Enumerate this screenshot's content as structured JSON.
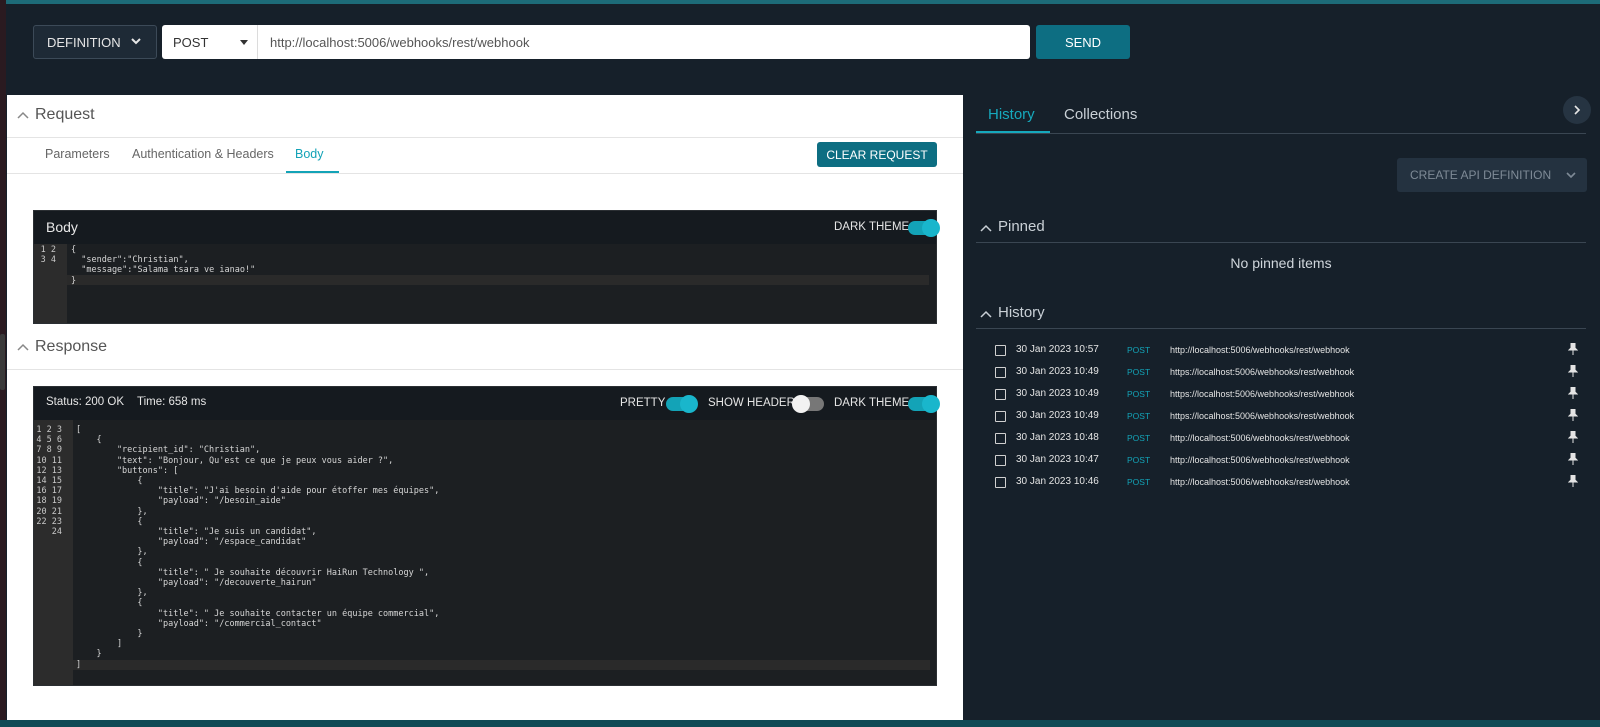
{
  "topbar": {
    "definition_label": "DEFINITION",
    "method": "POST",
    "url": "http://localhost:5006/webhooks/rest/webhook",
    "send_label": "SEND"
  },
  "request": {
    "title": "Request",
    "tabs": [
      "Parameters",
      "Authentication & Headers",
      "Body"
    ],
    "active_tab": "Body",
    "clear_label": "CLEAR REQUEST",
    "body_editor": {
      "title": "Body",
      "dark_theme_label": "DARK THEME",
      "dark_theme_on": true,
      "line_numbers": "1\n2\n3\n4",
      "code": "{\n  \"sender\":\"Christian\",\n  \"message\":\"Salama tsara ve ianao!\"\n}"
    }
  },
  "response": {
    "title": "Response",
    "status": "Status: 200 OK",
    "time": "Time: 658 ms",
    "pretty_label": "PRETTY",
    "pretty_on": true,
    "show_headers_label": "SHOW HEADERS",
    "show_headers_on": false,
    "dark_theme_label": "DARK THEME",
    "dark_theme_on": true,
    "line_numbers": "1\n2\n3\n4\n5\n6\n7\n8\n9\n10\n11\n12\n13\n14\n15\n16\n17\n18\n19\n20\n21\n22\n23\n24",
    "code": "[\n    {\n        \"recipient_id\": \"Christian\",\n        \"text\": \"Bonjour, Qu'est ce que je peux vous aider ?\",\n        \"buttons\": [\n            {\n                \"title\": \"J'ai besoin d'aide pour étoffer mes équipes\",\n                \"payload\": \"/besoin_aide\"\n            },\n            {\n                \"title\": \"Je suis un candidat\",\n                \"payload\": \"/espace_candidat\"\n            },\n            {\n                \"title\": \" Je souhaite découvrir HaiRun Technology \",\n                \"payload\": \"/decouverte_hairun\"\n            },\n            {\n                \"title\": \" Je souhaite contacter un équipe commercial\",\n                \"payload\": \"/commercial_contact\"\n            }\n        ]\n    }\n]"
  },
  "sidebar": {
    "tabs": [
      "History",
      "Collections"
    ],
    "active_tab": "History",
    "create_label": "CREATE API DEFINITION",
    "pinned_title": "Pinned",
    "no_pinned": "No pinned items",
    "history_title": "History",
    "history": [
      {
        "date": "30 Jan 2023 10:57",
        "method": "POST",
        "url": "http://localhost:5006/webhooks/rest/webhook"
      },
      {
        "date": "30 Jan 2023 10:49",
        "method": "POST",
        "url": "https://localhost:5006/webhooks/rest/webhook"
      },
      {
        "date": "30 Jan 2023 10:49",
        "method": "POST",
        "url": "https://localhost:5006/webhooks/rest/webhook"
      },
      {
        "date": "30 Jan 2023 10:49",
        "method": "POST",
        "url": "https://localhost:5006/webhooks/rest/webhook"
      },
      {
        "date": "30 Jan 2023 10:48",
        "method": "POST",
        "url": "http://localhost:5006/webhooks/rest/webhook"
      },
      {
        "date": "30 Jan 2023 10:47",
        "method": "POST",
        "url": "http://localhost:5006/webhooks/rest/webhook"
      },
      {
        "date": "30 Jan 2023 10:46",
        "method": "POST",
        "url": "http://localhost:5006/webhooks/rest/webhook"
      }
    ]
  },
  "colors": {
    "accent": "#13a3b7",
    "button": "#0d6e82",
    "background": "#16202a"
  }
}
